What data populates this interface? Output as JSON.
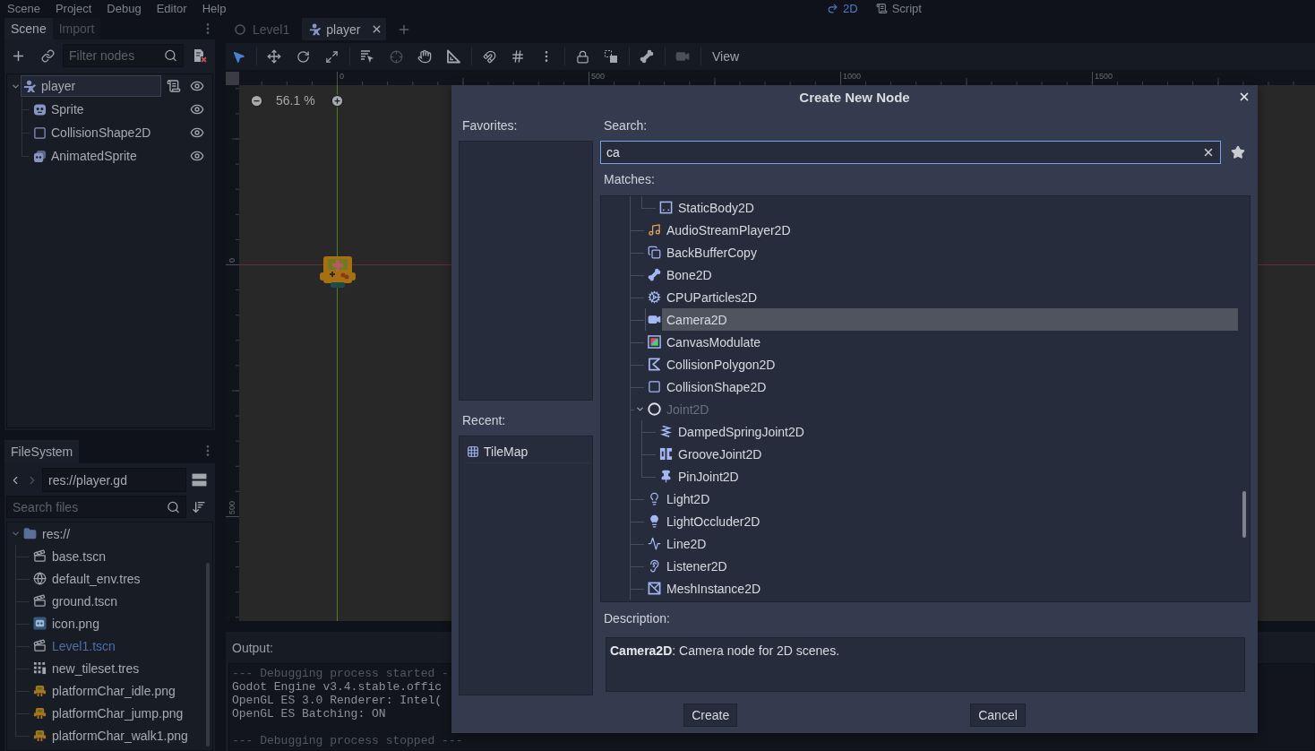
{
  "menu_bar": {
    "menus": [
      "Scene",
      "Project",
      "Debug",
      "Editor",
      "Help"
    ],
    "workspaces": [
      {
        "label": "2D",
        "kind": "canvas",
        "selected": true
      },
      {
        "label": "Script",
        "kind": "script",
        "selected": false
      }
    ]
  },
  "scene_dock": {
    "tabs": [
      {
        "label": "Scene",
        "selected": true
      },
      {
        "label": "Import",
        "selected": false
      }
    ],
    "filter": {
      "placeholder": "Filter nodes"
    },
    "tree": [
      {
        "label": "player",
        "kind": "character",
        "selected": true,
        "expanded": true,
        "script": true,
        "visible": true,
        "children": [
          {
            "label": "Sprite",
            "kind": "sprite",
            "selected": false,
            "script": false,
            "visible": true
          },
          {
            "label": "CollisionShape2D",
            "kind": "shape",
            "selected": false,
            "script": false,
            "visible": true
          },
          {
            "label": "AnimatedSprite",
            "kind": "animated",
            "selected": false,
            "script": false,
            "visible": true
          }
        ]
      }
    ]
  },
  "filesystem_dock": {
    "tabs": [
      {
        "label": "FileSystem",
        "selected": true
      }
    ],
    "path": "res://player.gd",
    "search": {
      "placeholder": "Search files"
    },
    "tree": [
      {
        "label": "res://",
        "kind": "folder",
        "expanded": true,
        "main_scene": false,
        "children": [
          {
            "label": "base.tscn",
            "kind": "scene",
            "main_scene": false
          },
          {
            "label": "default_env.tres",
            "kind": "environment",
            "main_scene": false
          },
          {
            "label": "ground.tscn",
            "kind": "scene",
            "main_scene": false
          },
          {
            "label": "icon.png",
            "kind": "image",
            "main_scene": false
          },
          {
            "label": "Level1.tscn",
            "kind": "scene",
            "main_scene": true
          },
          {
            "label": "new_tileset.tres",
            "kind": "tileset",
            "main_scene": false
          },
          {
            "label": "platformChar_idle.png",
            "kind": "sprite",
            "main_scene": false
          },
          {
            "label": "platformChar_jump.png",
            "kind": "sprite",
            "main_scene": false
          },
          {
            "label": "platformChar_walk1.png",
            "kind": "sprite",
            "main_scene": false
          }
        ]
      }
    ]
  },
  "scene_tabs": [
    {
      "label": "Level1",
      "kind": "scene",
      "selected": false
    },
    {
      "label": "player",
      "kind": "character",
      "selected": true
    }
  ],
  "toolbar": {
    "tool_groups": [
      {
        "tools": [
          {
            "kind": "select",
            "selected": true,
            "disabled": false
          }
        ]
      },
      {
        "tools": [
          {
            "kind": "move",
            "selected": false,
            "disabled": false
          },
          {
            "kind": "rotate",
            "selected": false,
            "disabled": false
          },
          {
            "kind": "scale",
            "selected": false,
            "disabled": false
          }
        ]
      },
      {
        "tools": [
          {
            "kind": "list_select",
            "selected": false,
            "disabled": false
          },
          {
            "kind": "pivot",
            "selected": false,
            "disabled": true
          },
          {
            "kind": "pan",
            "selected": false,
            "disabled": false
          },
          {
            "kind": "ruler",
            "selected": false,
            "disabled": false
          }
        ]
      },
      {
        "tools": [
          {
            "kind": "smart_snap",
            "selected": false,
            "disabled": false
          },
          {
            "kind": "grid_snap",
            "selected": false,
            "disabled": false
          },
          {
            "kind": "snap_options",
            "selected": false,
            "disabled": false
          }
        ]
      },
      {
        "tools": [
          {
            "kind": "lock",
            "selected": false,
            "disabled": false
          },
          {
            "kind": "group",
            "selected": false,
            "disabled": false
          }
        ]
      },
      {
        "tools": [
          {
            "kind": "bone",
            "selected": false,
            "disabled": false
          }
        ]
      },
      {
        "tools": [
          {
            "kind": "camera",
            "selected": false,
            "disabled": true
          }
        ]
      }
    ],
    "view_menu": "View"
  },
  "viewport": {
    "top_ruler": [
      "0",
      "500",
      "1000",
      "1500"
    ],
    "left_ruler": [
      "0",
      "500"
    ],
    "zoom": "56.1 %"
  },
  "output": {
    "label": "Output:",
    "lines": [
      {
        "text": "--- Debugging process started -",
        "kind": "marker"
      },
      {
        "text": "Godot Engine v3.4.stable.offic",
        "kind": "log"
      },
      {
        "text": "OpenGL ES 3.0 Renderer: Intel(",
        "kind": "log"
      },
      {
        "text": "OpenGL ES Batching: ON",
        "kind": "log"
      },
      {
        "text": "--- Debugging process stopped ---",
        "kind": "marker"
      }
    ]
  },
  "dialog": {
    "title": "Create New Node",
    "favorites": {
      "label": "Favorites:"
    },
    "recent": {
      "label": "Recent:",
      "items": [
        {
          "label": "TileMap",
          "kind": "tilemap",
          "selected": false
        }
      ]
    },
    "search": {
      "label": "Search:",
      "value": "ca"
    },
    "matches": {
      "label": "Matches:",
      "items": [
        {
          "children": [
            {
              "label": "StaticBody2D",
              "kind": "staticbody",
              "selected": false,
              "disabled": false
            }
          ]
        },
        {
          "label": "AudioStreamPlayer2D",
          "kind": "audio",
          "selected": false,
          "disabled": false
        },
        {
          "label": "BackBufferCopy",
          "kind": "backbuffer",
          "selected": false,
          "disabled": false
        },
        {
          "label": "Bone2D",
          "kind": "bone",
          "selected": false,
          "disabled": false
        },
        {
          "label": "CPUParticles2D",
          "kind": "particles",
          "selected": false,
          "disabled": false
        },
        {
          "label": "Camera2D",
          "kind": "camera",
          "selected": true,
          "disabled": false
        },
        {
          "label": "CanvasModulate",
          "kind": "modulate",
          "selected": false,
          "disabled": false
        },
        {
          "label": "CollisionPolygon2D",
          "kind": "polygon",
          "selected": false,
          "disabled": false
        },
        {
          "label": "CollisionShape2D",
          "kind": "shape",
          "selected": false,
          "disabled": false
        },
        {
          "label": "Joint2D",
          "kind": "joint",
          "selected": false,
          "disabled": true,
          "expanded": true,
          "children": [
            {
              "label": "DampedSpringJoint2D",
              "kind": "spring",
              "selected": false,
              "disabled": false
            },
            {
              "label": "GrooveJoint2D",
              "kind": "groove",
              "selected": false,
              "disabled": false
            },
            {
              "label": "PinJoint2D",
              "kind": "pin",
              "selected": false,
              "disabled": false
            }
          ]
        },
        {
          "label": "Light2D",
          "kind": "light",
          "selected": false,
          "disabled": false
        },
        {
          "label": "LightOccluder2D",
          "kind": "occluder",
          "selected": false,
          "disabled": false
        },
        {
          "label": "Line2D",
          "kind": "line",
          "selected": false,
          "disabled": false
        },
        {
          "label": "Listener2D",
          "kind": "listener",
          "selected": false,
          "disabled": false
        },
        {
          "label": "MeshInstance2D",
          "kind": "mesh",
          "selected": false,
          "disabled": false
        }
      ]
    },
    "description": {
      "label": "Description:",
      "text": "**Camera2D**: Camera node for 2D scenes."
    },
    "buttons": [
      {
        "label": "Create"
      },
      {
        "label": "Cancel"
      }
    ]
  }
}
